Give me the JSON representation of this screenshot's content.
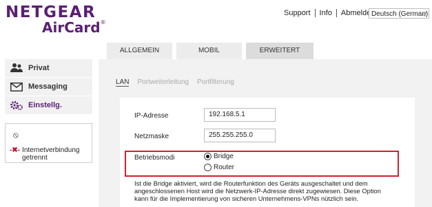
{
  "brand": {
    "line1": "NETGEAR",
    "line2": "AirCard",
    "tm": "®"
  },
  "topnav": {
    "support": "Support",
    "info": "Info",
    "logout": "Abmelden"
  },
  "language": {
    "selected": "Deutsch (German)"
  },
  "tabs": [
    {
      "label": "ALLGEMEIN"
    },
    {
      "label": "MOBIL"
    },
    {
      "label": "ERWEITERT",
      "active": true
    }
  ],
  "sidebar": {
    "items": [
      {
        "label": "Privat",
        "icon": "users-icon"
      },
      {
        "label": "Messaging",
        "icon": "envelope-icon"
      },
      {
        "label": "Einstellg.",
        "icon": "gears-icon",
        "active": true
      }
    ]
  },
  "status": {
    "no_service_icon": "⦸",
    "connection_text": "Internetverbindung getrennt"
  },
  "subtabs": [
    {
      "label": "LAN",
      "active": true
    },
    {
      "label": "Portweiterleitung"
    },
    {
      "label": "Portfilterung"
    }
  ],
  "form": {
    "ip_label": "IP-Adresse",
    "ip_value": "192.168.5.1",
    "mask_label": "Netzmaske",
    "mask_value": "255.255.255.0",
    "mode_label": "Betriebsmodi",
    "mode_options": [
      {
        "label": "Bridge",
        "selected": true
      },
      {
        "label": "Router",
        "selected": false
      }
    ],
    "description": "Ist die Bridge aktiviert, wird die Routerfunktion des Geräts ausgeschaltet und dem angeschlossenen Host wird die Netzwerk-IP-Adresse direkt zugewiesen. Diese Option kann für die Implementierung von sicheren Unternehmens-VPNs nützlich sein."
  },
  "colors": {
    "brand": "#5a1f73",
    "highlight": "#d0202b",
    "disconnected": "#c0102a"
  }
}
